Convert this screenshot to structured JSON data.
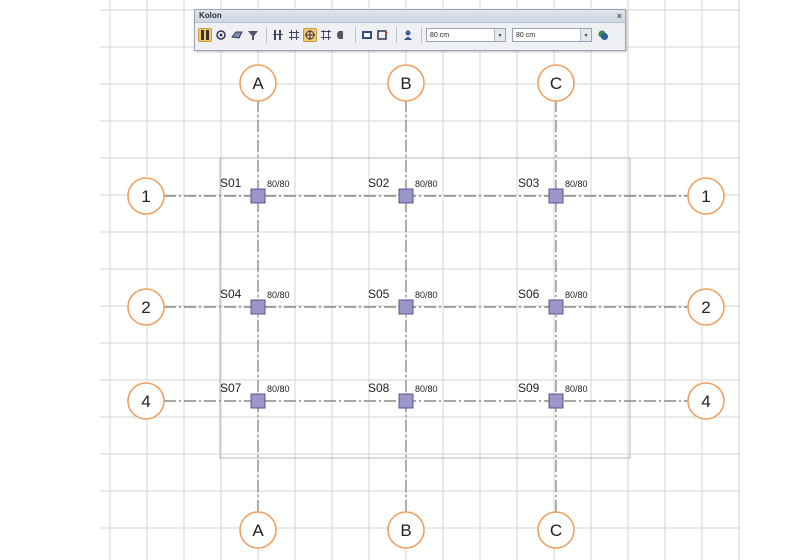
{
  "toolbar": {
    "title": "Kolon",
    "close_glyph": "×",
    "width_value": "80 cm",
    "depth_value": "80 cm",
    "tools": [
      {
        "icon": "column-select-icon",
        "active": true
      },
      {
        "icon": "circle-column-icon",
        "active": false
      },
      {
        "icon": "polygon-column-icon",
        "active": false
      },
      {
        "icon": "funnel-column-icon",
        "active": false
      },
      {
        "icon": "align-top-icon",
        "active": false
      },
      {
        "icon": "align-middle-icon",
        "active": false
      },
      {
        "icon": "align-center-icon",
        "active": true
      },
      {
        "icon": "align-bottom-icon",
        "active": false
      },
      {
        "icon": "align-edge-icon",
        "active": false
      },
      {
        "icon": "rectangle-icon",
        "active": false
      },
      {
        "icon": "rotate-icon",
        "active": false
      },
      {
        "icon": "user-icon",
        "active": false
      }
    ],
    "end_icon": "layers-icon"
  },
  "axes": {
    "letters": [
      "A",
      "B",
      "C"
    ],
    "numbers": [
      "1",
      "2",
      "4"
    ]
  },
  "columns": [
    {
      "name": "S01",
      "size": "80/80"
    },
    {
      "name": "S02",
      "size": "80/80"
    },
    {
      "name": "S03",
      "size": "80/80"
    },
    {
      "name": "S04",
      "size": "80/80"
    },
    {
      "name": "S05",
      "size": "80/80"
    },
    {
      "name": "S06",
      "size": "80/80"
    },
    {
      "name": "S07",
      "size": "80/80"
    },
    {
      "name": "S08",
      "size": "80/80"
    },
    {
      "name": "S09",
      "size": "80/80"
    }
  ],
  "colors": {
    "grid_line": "#d6d6d6",
    "axis_line": "#8a8a8a",
    "bubble_stroke": "#f0a060",
    "column_fill": "#9b96c8",
    "column_stroke": "#5a5592",
    "frame": "#b4b4b4"
  }
}
